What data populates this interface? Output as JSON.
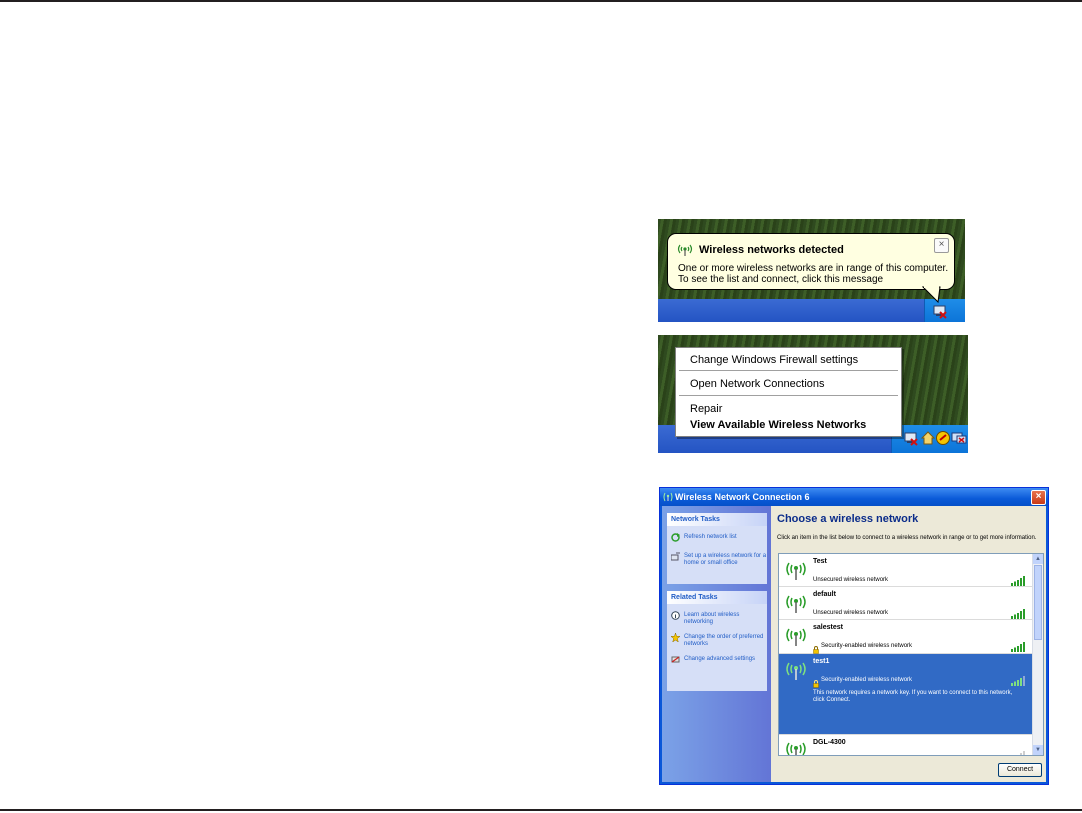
{
  "balloon": {
    "title": "Wireless networks detected",
    "line1": "One or more wireless networks are in range of this computer.",
    "line2": "To see the list and connect, click this message",
    "close_glyph": "×"
  },
  "context_menu": {
    "items": [
      {
        "label": "Change Windows Firewall settings"
      },
      {
        "label": "Open Network Connections"
      },
      {
        "label": "Repair"
      },
      {
        "label": "View Available Wireless Networks"
      }
    ]
  },
  "window": {
    "title": "Wireless Network Connection 6",
    "close_glyph": "×",
    "network_tasks": {
      "header": "Network Tasks",
      "items": [
        {
          "label": "Refresh network list",
          "icon": "refresh-icon"
        },
        {
          "label": "Set up a wireless network for a home or small office",
          "icon": "setup-network-icon"
        }
      ]
    },
    "related_tasks": {
      "header": "Related Tasks",
      "items": [
        {
          "label": "Learn about wireless networking",
          "icon": "info-icon"
        },
        {
          "label": "Change the order of preferred networks",
          "icon": "star-icon"
        },
        {
          "label": "Change advanced settings",
          "icon": "settings-icon"
        }
      ]
    },
    "main_title": "Choose a wireless network",
    "description": "Click an item in the list below to connect to a wireless network in range or to get more information.",
    "networks": [
      {
        "name": "Test",
        "status": "Unsecured wireless network",
        "secured": false,
        "selected": false,
        "signal": 5
      },
      {
        "name": "default",
        "status": "Unsecured wireless network",
        "secured": false,
        "selected": false,
        "signal": 5
      },
      {
        "name": "salestest",
        "status": "Security-enabled wireless network",
        "secured": true,
        "selected": false,
        "signal": 5
      },
      {
        "name": "test1",
        "status": "Security-enabled wireless network",
        "secured": true,
        "selected": true,
        "signal": 4,
        "extra": "This network requires a network key. If you want to connect to this network, click Connect."
      },
      {
        "name": "DGL-4300",
        "status": "",
        "secured": false,
        "selected": false,
        "signal": 1
      }
    ],
    "connect_label": "Connect",
    "scroll_up_glyph": "▲",
    "scroll_down_glyph": "▼"
  },
  "colors": {
    "rule": "#231f20",
    "xp_blue": "#0a58d8",
    "selection": "#316ac5",
    "balloon_bg": "#ffffe1"
  }
}
